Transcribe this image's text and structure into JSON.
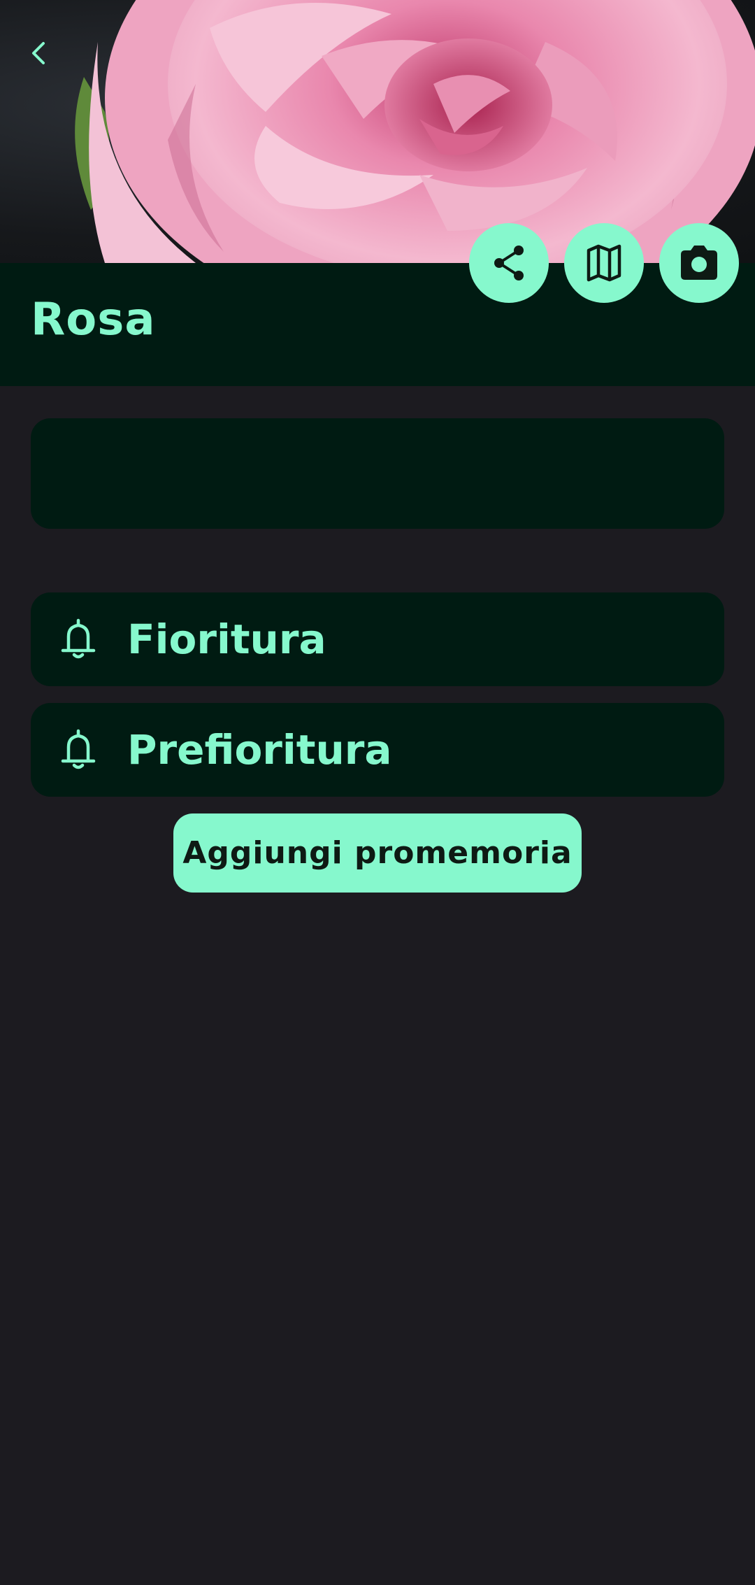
{
  "plant": {
    "name": "Rosa"
  },
  "actions": {
    "share_icon": "share-icon",
    "map_icon": "map-icon",
    "camera_icon": "camera-icon"
  },
  "reminders": [
    {
      "label": "Fioritura",
      "icon": "bell-icon"
    },
    {
      "label": "Prefioritura",
      "icon": "bell-icon"
    }
  ],
  "add_reminder_label": "Aggiungi promemoria",
  "colors": {
    "background": "#1c1b20",
    "surface": "#001b12",
    "accent": "#86f8cd",
    "on_accent": "#0e1a14"
  }
}
